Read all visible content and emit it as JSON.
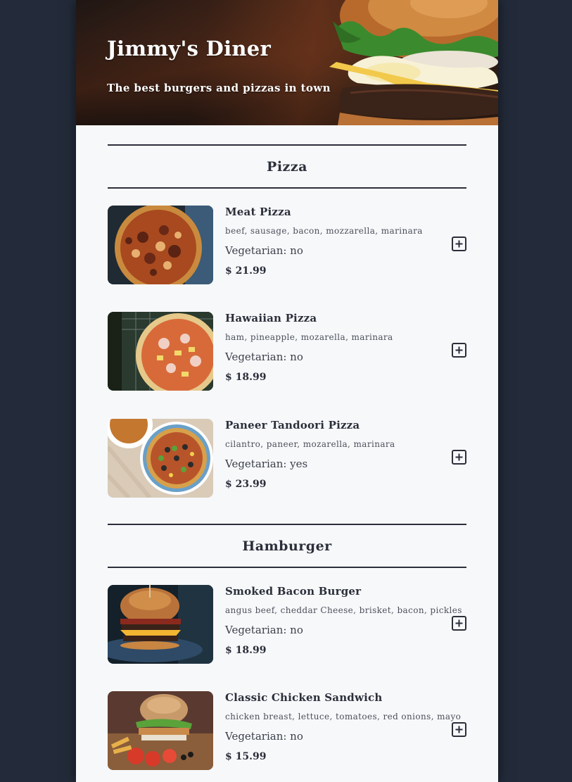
{
  "header": {
    "title": "Jimmy's Diner",
    "subtitle": "The best burgers and pizzas in town"
  },
  "sections": [
    {
      "title": "Pizza",
      "items": [
        {
          "name": "Meat Pizza",
          "ingredients": "beef, sausage, bacon, mozzarella, marinara",
          "vegetarian": "Vegetarian: no",
          "price": "$ 21.99",
          "image": "meat-pizza-photo"
        },
        {
          "name": "Hawaiian Pizza",
          "ingredients": "ham, pineapple, mozarella, marinara",
          "vegetarian": "Vegetarian: no",
          "price": "$ 18.99",
          "image": "hawaiian-pizza-photo"
        },
        {
          "name": "Paneer Tandoori Pizza",
          "ingredients": "cilantro, paneer, mozarella, marinara",
          "vegetarian": "Vegetarian: yes",
          "price": "$ 23.99",
          "image": "paneer-pizza-photo"
        }
      ]
    },
    {
      "title": "Hamburger",
      "items": [
        {
          "name": "Smoked Bacon Burger",
          "ingredients": "angus beef, cheddar Cheese, brisket, bacon, pickles",
          "vegetarian": "Vegetarian: no",
          "price": "$ 18.99",
          "image": "bacon-burger-photo"
        },
        {
          "name": "Classic Chicken Sandwich",
          "ingredients": "chicken breast, lettuce, tomatoes, red onions, mayo",
          "vegetarian": "Vegetarian: no",
          "price": "$ 15.99",
          "image": "chicken-sandwich-photo"
        }
      ]
    }
  ],
  "icons": {
    "add": "plus-square-icon"
  },
  "colors": {
    "background": "#232b3a",
    "card": "#f7f8fa",
    "text": "#2b2f3a"
  }
}
